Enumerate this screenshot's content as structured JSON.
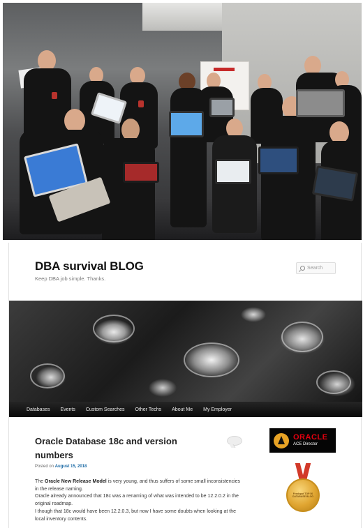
{
  "blog": {
    "title": "DBA survival BLOG",
    "description": "Keep DBA job simple. Thanks.",
    "search_placeholder": "Search"
  },
  "nav": {
    "items": [
      "Databases",
      "Events",
      "Custom Searches",
      "Other Techs",
      "About Me",
      "My Employer"
    ]
  },
  "post": {
    "title": "Oracle Database 18c and version numbers",
    "posted_prefix": "Posted on",
    "posted_date": "August 15, 2018",
    "p1_pre": "The",
    "p1_bold": "Oracle New Release Model",
    "p1_post": "is very young, and thus suffers of some small inconsistencies in the release naming.",
    "p2": "Oracle already announced that 18c was a renaming of what was intended to be 12.2.0.2 in the original roadmap.",
    "p3": "I though that 18c would have been 12.2.0.3, but now I have some doubts when looking at the local inventory contents."
  },
  "sidebar": {
    "ace_brand": "ORACLE",
    "ace_title": "ACE Director",
    "medal_text": "Feedspot TOP 50 DATABASE BLOG"
  },
  "colors": {
    "nav_bg": "#0a0a0a",
    "link": "#1b6aa5",
    "oracle_red": "#e3000f",
    "medal_gold": "#e0a531"
  }
}
